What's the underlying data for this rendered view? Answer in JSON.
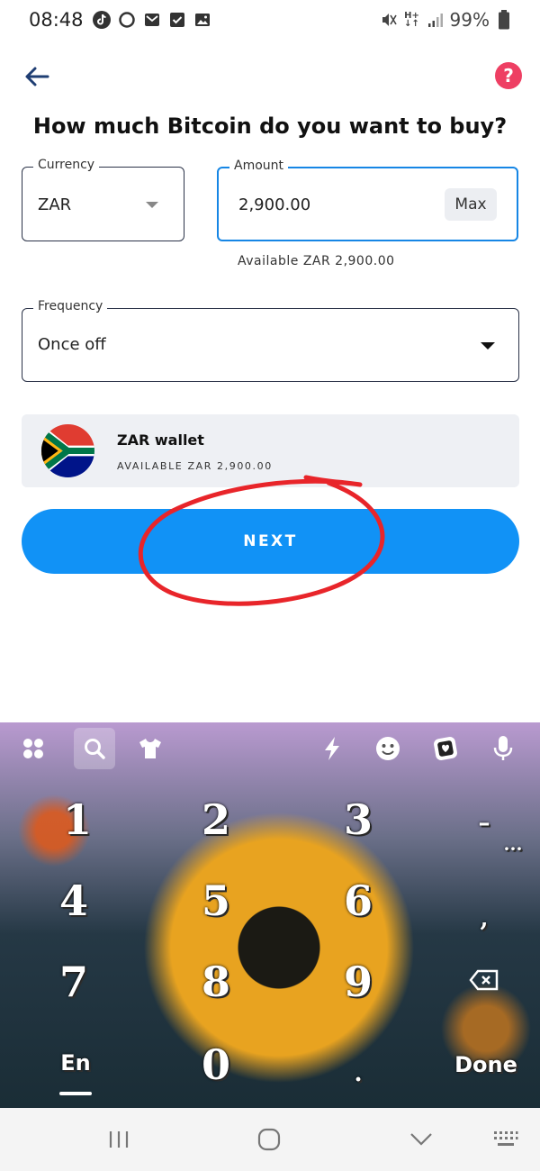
{
  "status_bar": {
    "time": "08:48",
    "battery": "99%"
  },
  "header": {
    "help_symbol": "?",
    "title": "How much Bitcoin do you want to buy?"
  },
  "form": {
    "currency": {
      "label": "Currency",
      "value": "ZAR"
    },
    "amount": {
      "label": "Amount",
      "value": "2,900.00",
      "max_label": "Max"
    },
    "available": "Available ZAR 2,900.00",
    "frequency": {
      "label": "Frequency",
      "value": "Once off"
    }
  },
  "wallet": {
    "name": "ZAR wallet",
    "available": "AVAILABLE ZAR 2,900.00"
  },
  "next_button": {
    "label": "NEXT"
  },
  "keyboard": {
    "keys": {
      "k1": "1",
      "k2": "2",
      "k3": "3",
      "dash": "–",
      "k4": "4",
      "k5": "5",
      "k6": "6",
      "comma": ",",
      "k7": "7",
      "k8": "8",
      "k9": "9",
      "lang": "En",
      "k0": "0",
      "dot": ".",
      "done": "Done",
      "more": "···"
    },
    "toolbar_icons": [
      "apps-icon",
      "search-icon",
      "shirt-icon",
      "lightning-icon",
      "emoji-icon",
      "sticker-icon",
      "mic-icon"
    ]
  },
  "colors": {
    "accent": "#1192f6",
    "focus_border": "#1686e5",
    "help": "#ee3f63",
    "annotation": "#e8252a"
  }
}
